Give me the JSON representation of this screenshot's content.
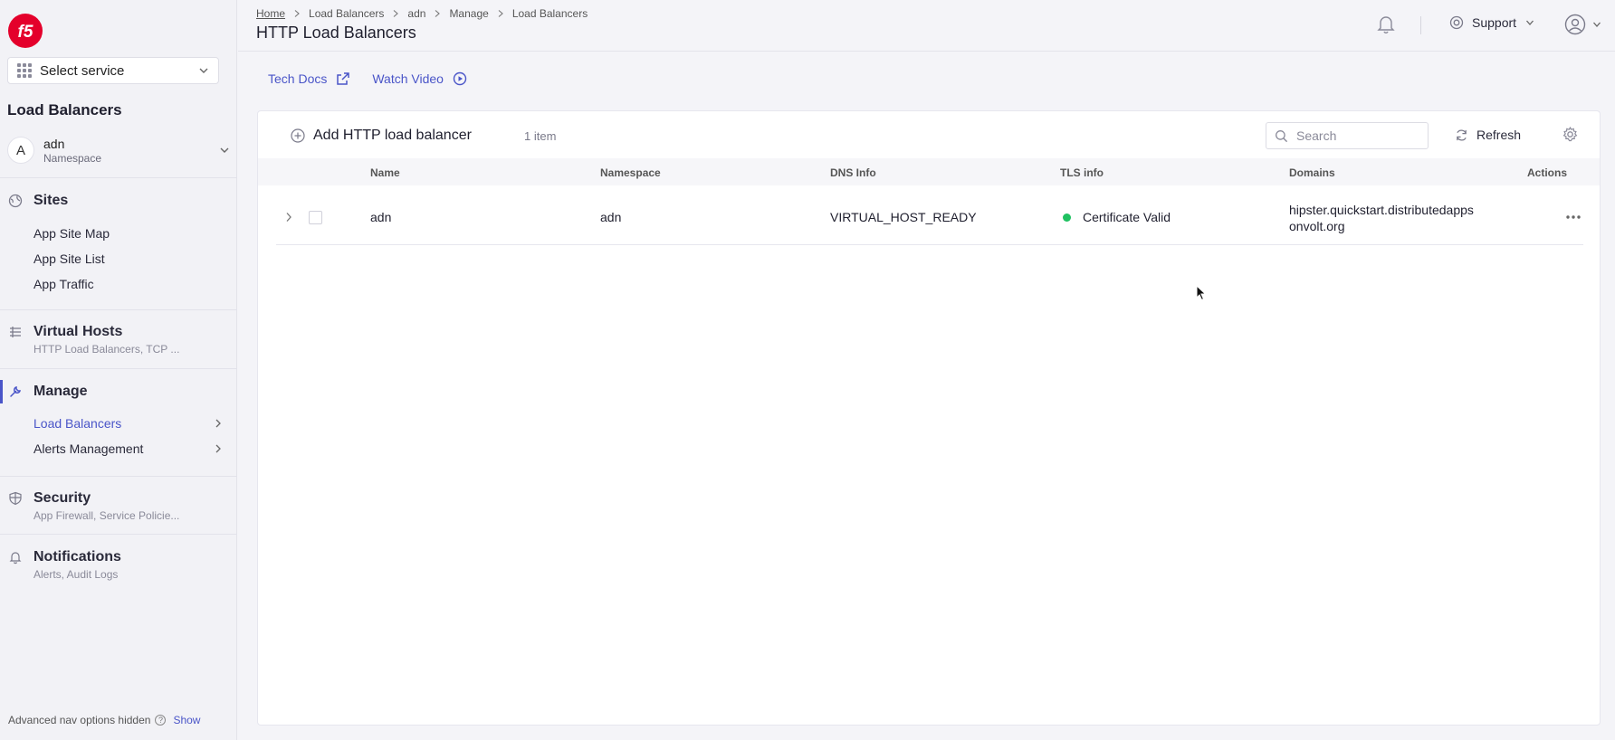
{
  "sidebar": {
    "service_select": "Select service",
    "title": "Load Balancers",
    "namespace": {
      "avatar": "A",
      "name": "adn",
      "label": "Namespace"
    },
    "sites": {
      "label": "Sites",
      "items": [
        "App Site Map",
        "App Site List",
        "App Traffic"
      ]
    },
    "virtual_hosts": {
      "label": "Virtual Hosts",
      "sub": "HTTP Load Balancers, TCP ..."
    },
    "manage": {
      "label": "Manage",
      "items": [
        "Load Balancers",
        "Alerts Management"
      ]
    },
    "security": {
      "label": "Security",
      "sub": "App Firewall, Service Policie..."
    },
    "notifications": {
      "label": "Notifications",
      "sub": "Alerts, Audit Logs"
    },
    "footer": {
      "text": "Advanced nav options hidden",
      "show": "Show"
    }
  },
  "header": {
    "breadcrumbs": [
      "Home",
      "Load Balancers",
      "adn",
      "Manage",
      "Load Balancers"
    ],
    "title": "HTTP Load Balancers",
    "support": "Support"
  },
  "links": {
    "tech_docs": "Tech Docs",
    "watch_video": "Watch Video"
  },
  "toolbar": {
    "add_label": "Add HTTP load balancer",
    "count": "1 item",
    "search_placeholder": "Search",
    "refresh": "Refresh"
  },
  "table": {
    "columns": [
      "Name",
      "Namespace",
      "DNS Info",
      "TLS info",
      "Domains",
      "Actions"
    ],
    "rows": [
      {
        "name": "adn",
        "namespace": "adn",
        "dns": "VIRTUAL_HOST_READY",
        "tls": "Certificate Valid",
        "domain": "hipster.quickstart.distributedappsonvolt.org"
      }
    ]
  },
  "colors": {
    "accent": "#4a55c8",
    "status_ok": "#1fc161",
    "logo": "#e4002b"
  }
}
